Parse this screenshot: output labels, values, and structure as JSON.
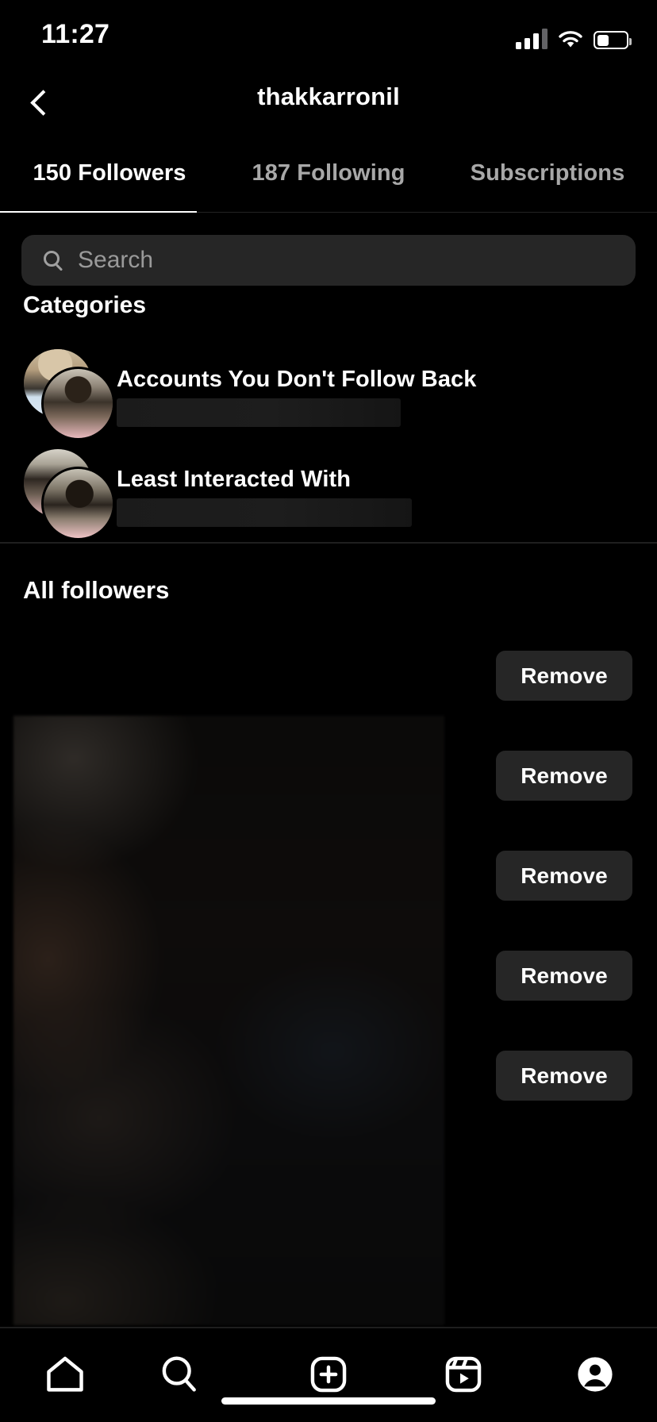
{
  "status_bar": {
    "time": "11:27",
    "signal_icon": "cellular-signal-icon",
    "wifi_icon": "wifi-icon",
    "battery_icon": "battery-icon",
    "battery_level_percent": 38
  },
  "header": {
    "back_icon": "chevron-left-icon",
    "title": "thakkarronil"
  },
  "tabs": [
    {
      "label": "150 Followers",
      "active": true
    },
    {
      "label": "187 Following",
      "active": false
    },
    {
      "label": "Subscriptions",
      "active": false
    }
  ],
  "search": {
    "icon": "search-icon",
    "placeholder": "Search",
    "value": ""
  },
  "categories": {
    "heading": "Categories",
    "items": [
      {
        "title": "Accounts You Don't Follow Back",
        "subtitle": "",
        "avatars_icon": "stacked-avatars-icon"
      },
      {
        "title": "Least Interacted With",
        "subtitle": "",
        "avatars_icon": "stacked-avatars-icon"
      }
    ]
  },
  "all_followers": {
    "heading": "All followers",
    "rows": [
      {
        "remove_label": "Remove"
      },
      {
        "remove_label": "Remove"
      },
      {
        "remove_label": "Remove"
      },
      {
        "remove_label": "Remove"
      },
      {
        "remove_label": "Remove"
      }
    ]
  },
  "bottom_nav": [
    {
      "icon": "home-icon",
      "name": "home"
    },
    {
      "icon": "search-icon",
      "name": "search"
    },
    {
      "icon": "create-icon",
      "name": "create"
    },
    {
      "icon": "reels-icon",
      "name": "reels"
    },
    {
      "icon": "profile-icon",
      "name": "profile"
    }
  ],
  "colors": {
    "background": "#000000",
    "surface": "#262626",
    "text_primary": "#ffffff",
    "text_secondary": "#a8a8a8",
    "divider": "#1f1f1f"
  }
}
